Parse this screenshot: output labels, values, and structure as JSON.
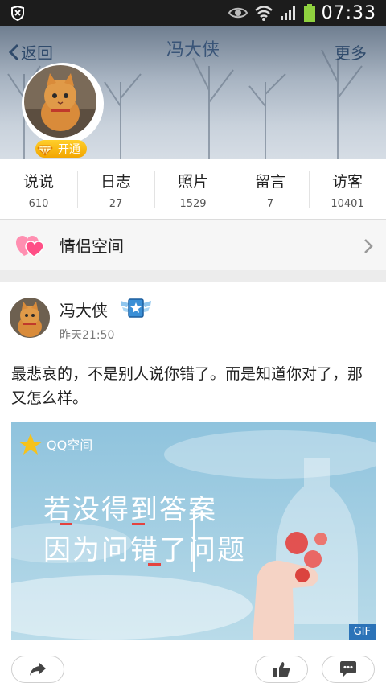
{
  "status_bar": {
    "time": "07:33"
  },
  "header": {
    "back_label": "返回",
    "title": "冯大侠",
    "more_label": "更多",
    "vip_label": "开通"
  },
  "stats": [
    {
      "label": "说说",
      "count": "610"
    },
    {
      "label": "日志",
      "count": "27"
    },
    {
      "label": "照片",
      "count": "1529"
    },
    {
      "label": "留言",
      "count": "7"
    },
    {
      "label": "访客",
      "count": "10401"
    }
  ],
  "couple_space": {
    "label": "情侣空间"
  },
  "post": {
    "author": "冯大侠",
    "time": "昨天21:50",
    "text": "最悲哀的，不是别人说你错了。而是知道你对了，那又怎么样。",
    "image": {
      "brand": "QQ空间",
      "line1": "若没得到答案",
      "line2": "因为问错了问题",
      "tag": "GIF"
    }
  },
  "colors": {
    "accent": "#2f4a6b",
    "vip": "#f2a500",
    "gif_tag": "#2b73b8",
    "heart": "#ff6b9a"
  }
}
